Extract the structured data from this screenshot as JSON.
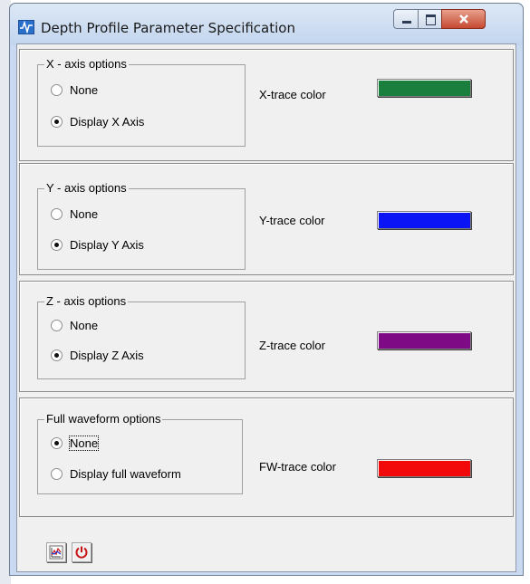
{
  "window": {
    "title": "Depth Profile Parameter Specification",
    "controls": [
      "minimize-icon",
      "maximize-icon",
      "close-icon"
    ]
  },
  "sections": [
    {
      "group_title": "X - axis options",
      "options": [
        {
          "label": "None",
          "checked": false
        },
        {
          "label": "Display X Axis",
          "checked": true
        }
      ],
      "trace_label": "X-trace color",
      "trace_color": "#1a7f3c"
    },
    {
      "group_title": "Y - axis options",
      "options": [
        {
          "label": "None",
          "checked": false
        },
        {
          "label": "Display Y Axis",
          "checked": true
        }
      ],
      "trace_label": "Y-trace color",
      "trace_color": "#0a14f5"
    },
    {
      "group_title": "Z - axis options",
      "options": [
        {
          "label": "None",
          "checked": false
        },
        {
          "label": "Display Z Axis",
          "checked": true
        }
      ],
      "trace_label": "Z-trace color",
      "trace_color": "#7e0a86"
    },
    {
      "group_title": "Full waveform options",
      "options": [
        {
          "label": "None",
          "checked": true
        },
        {
          "label": "Display full waveform",
          "checked": false
        }
      ],
      "trace_label": "FW-trace color",
      "trace_color": "#f20a0a"
    }
  ],
  "toolbar": {
    "buttons": [
      {
        "icon": "chart-plot-icon"
      },
      {
        "icon": "power-icon"
      }
    ]
  }
}
